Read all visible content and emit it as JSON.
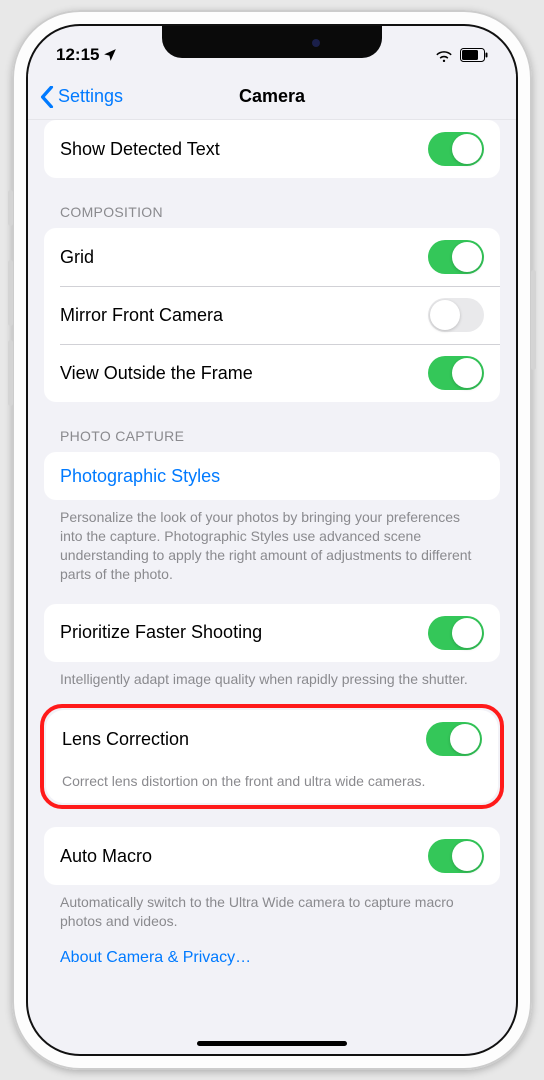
{
  "status_bar": {
    "time": "12:15"
  },
  "nav": {
    "back_label": "Settings",
    "title": "Camera"
  },
  "sections": {
    "top": {
      "show_detected_text": "Show Detected Text"
    },
    "composition": {
      "header": "COMPOSITION",
      "grid": "Grid",
      "mirror": "Mirror Front Camera",
      "view_outside": "View Outside the Frame"
    },
    "photo_capture": {
      "header": "PHOTO CAPTURE",
      "styles": "Photographic Styles",
      "styles_footer": "Personalize the look of your photos by bringing your preferences into the capture. Photographic Styles use advanced scene understanding to apply the right amount of adjustments to different parts of the photo.",
      "prioritize": "Prioritize Faster Shooting",
      "prioritize_footer": "Intelligently adapt image quality when rapidly pressing the shutter.",
      "lens": "Lens Correction",
      "lens_footer": "Correct lens distortion on the front and ultra wide cameras.",
      "macro": "Auto Macro",
      "macro_footer": "Automatically switch to the Ultra Wide camera to capture macro photos and videos.",
      "privacy_link": "About Camera & Privacy…"
    }
  },
  "toggles": {
    "show_detected_text": true,
    "grid": true,
    "mirror": false,
    "view_outside": true,
    "prioritize": true,
    "lens": true,
    "macro": true
  }
}
